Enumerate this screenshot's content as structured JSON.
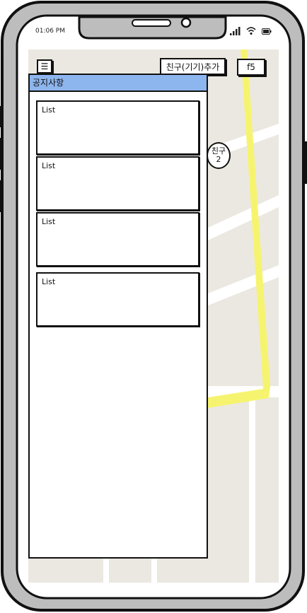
{
  "status_bar": {
    "time": "01:06 PM"
  },
  "toolbar": {
    "menu_label": "☰",
    "add_friend_label": "친구(기기)추가",
    "refresh_label": "f5"
  },
  "map": {
    "friend_marker": {
      "line1": "친구",
      "line2": "2"
    }
  },
  "notice_panel": {
    "title": "공지사항",
    "items": [
      {
        "label": "List"
      },
      {
        "label": "List"
      },
      {
        "label": "List"
      },
      {
        "label": "List"
      }
    ]
  },
  "colors": {
    "header_bg": "#8db5ee",
    "route": "#f6f46e",
    "map_bg": "#ebe8e1",
    "road": "#ffffff"
  },
  "icons": [
    "signal-icon",
    "wifi-icon",
    "battery-icon",
    "menu-icon"
  ]
}
